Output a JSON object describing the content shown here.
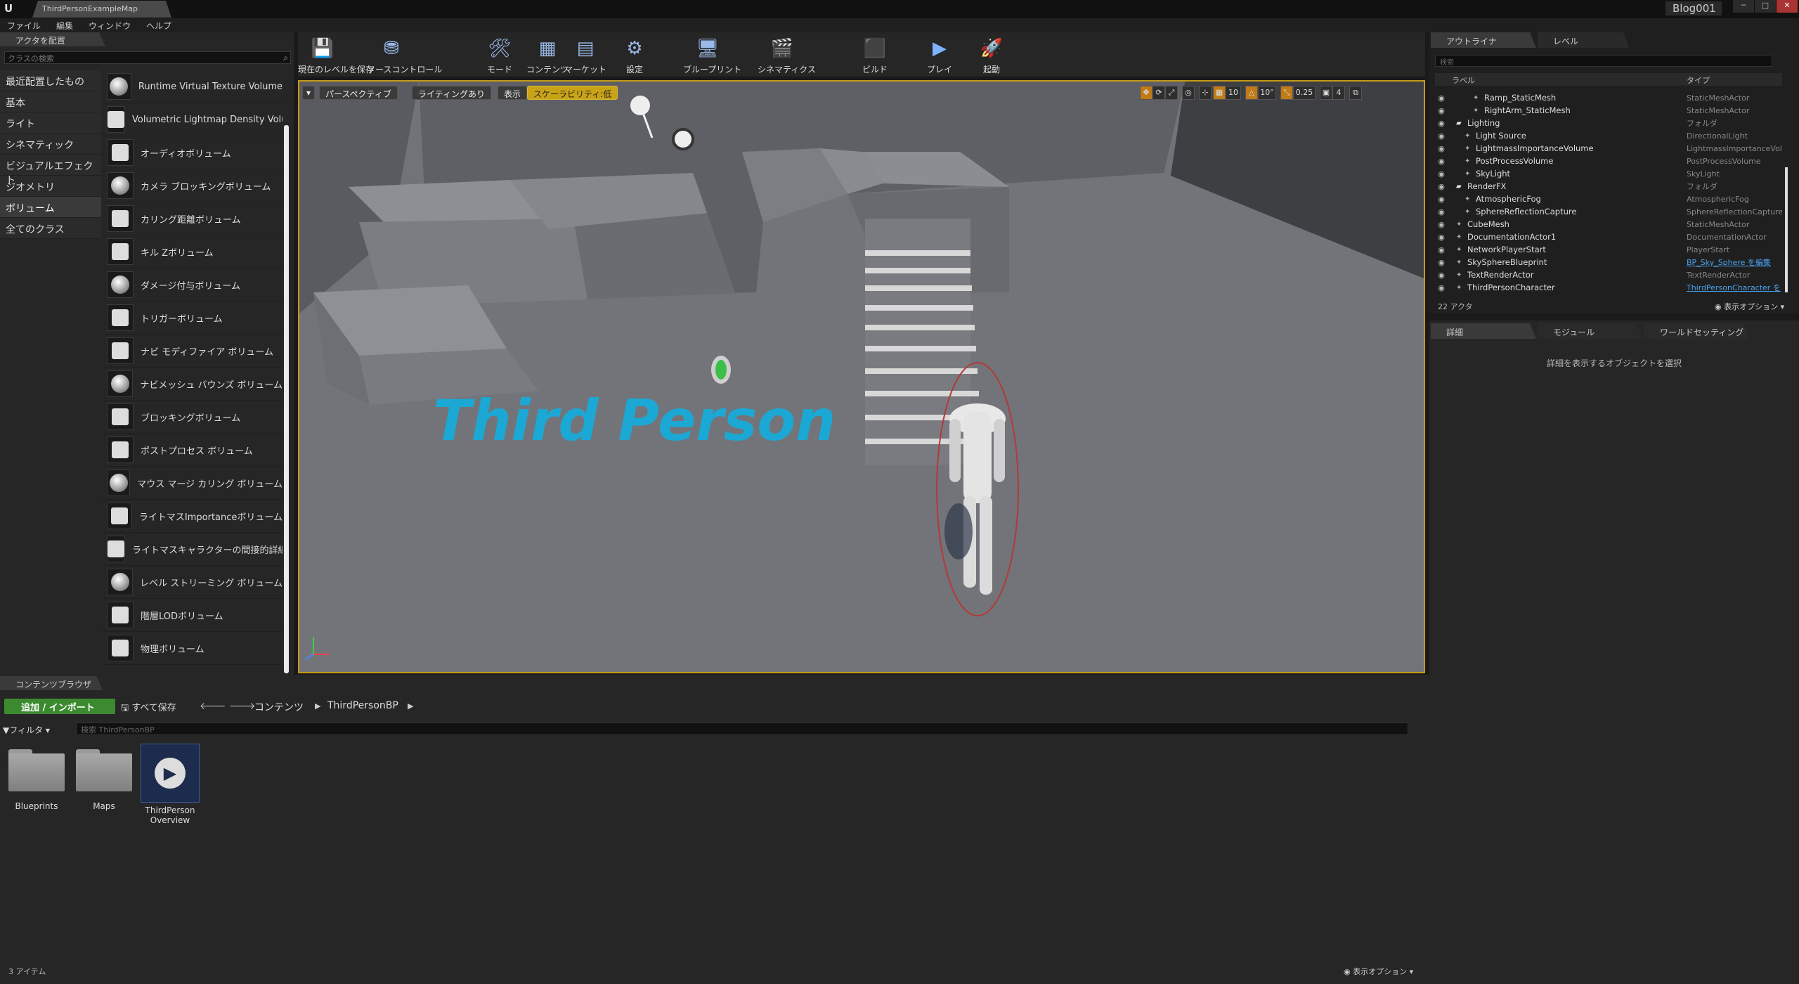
{
  "window": {
    "tab": "ThirdPersonExampleMap",
    "project": "Blog001",
    "min": "─",
    "max": "□",
    "close": "✕"
  },
  "menu": [
    "ファイル",
    "編集",
    "ウィンドウ",
    "ヘルプ"
  ],
  "place_panel": {
    "tab": "アクタを配置",
    "search_placeholder": "クラスの検索",
    "categories": [
      "最近配置したもの",
      "基本",
      "ライト",
      "シネマティック",
      "ビジュアルエフェクト",
      "ジオメトリ",
      "ボリューム",
      "全てのクラス"
    ],
    "actors": [
      "Runtime Virtual Texture Volume",
      "Volumetric Lightmap Density Volum",
      "オーディオボリューム",
      "カメラ ブロッキングボリューム",
      "カリング距離ボリューム",
      "キル Zボリューム",
      "ダメージ付与ボリューム",
      "トリガーボリューム",
      "ナビ モディファイア ボリューム",
      "ナビメッシュ バウンズ ボリューム",
      "ブロッキングボリューム",
      "ポストプロセス ボリューム",
      "マウス マージ カリング ボリューム",
      "ライトマスImportanceボリューム",
      "ライトマスキャラクターの間接的詳細",
      "レベル ストリーミング ボリューム",
      "階層LODボリューム",
      "物理ボリューム"
    ]
  },
  "toolbar": [
    "現在のレベルを保存",
    "ソースコントロール",
    "モード",
    "コンテンツ",
    "マーケット",
    "設定",
    "ブループリント",
    "シネマティクス",
    "ビルド",
    "プレイ",
    "起動"
  ],
  "viewport": {
    "perspective": "パースペクティブ",
    "lighting": "ライティングあり",
    "show": "表示",
    "scalability": "スケーラビリティ:低",
    "grid": "10",
    "rot": "10°",
    "scale": "0.25",
    "cam": "4",
    "text3d": "Third Person"
  },
  "outliner": {
    "tab": "アウトライナ",
    "tab2": "レベル",
    "search_placeholder": "検索",
    "col_label": "ラベル",
    "col_type": "タイプ",
    "rows": [
      {
        "indent": 3,
        "name": "Ramp_StaticMesh",
        "type": "StaticMeshActor",
        "link": false
      },
      {
        "indent": 3,
        "name": "RightArm_StaticMesh",
        "type": "StaticMeshActor",
        "link": false
      },
      {
        "indent": 1,
        "name": "Lighting",
        "type": "フォルダ",
        "link": false,
        "folder": true
      },
      {
        "indent": 2,
        "name": "Light Source",
        "type": "DirectionalLight",
        "link": false
      },
      {
        "indent": 2,
        "name": "LightmassImportanceVolume",
        "type": "LightmassImportanceVol",
        "link": false
      },
      {
        "indent": 2,
        "name": "PostProcessVolume",
        "type": "PostProcessVolume",
        "link": false
      },
      {
        "indent": 2,
        "name": "SkyLight",
        "type": "SkyLight",
        "link": false
      },
      {
        "indent": 1,
        "name": "RenderFX",
        "type": "フォルダ",
        "link": false,
        "folder": true
      },
      {
        "indent": 2,
        "name": "AtmosphericFog",
        "type": "AtmosphericFog",
        "link": false
      },
      {
        "indent": 2,
        "name": "SphereReflectionCapture",
        "type": "SphereReflectionCapture",
        "link": false
      },
      {
        "indent": 1,
        "name": "CubeMesh",
        "type": "StaticMeshActor",
        "link": false
      },
      {
        "indent": 1,
        "name": "DocumentationActor1",
        "type": "DocumentationActor",
        "link": false
      },
      {
        "indent": 1,
        "name": "NetworkPlayerStart",
        "type": "PlayerStart",
        "link": false
      },
      {
        "indent": 1,
        "name": "SkySphereBlueprint",
        "type": "BP_Sky_Sphere を編集",
        "link": true
      },
      {
        "indent": 1,
        "name": "TextRenderActor",
        "type": "TextRenderActor",
        "link": false
      },
      {
        "indent": 1,
        "name": "ThirdPersonCharacter",
        "type": "ThirdPersonCharacter を",
        "link": true
      }
    ],
    "count": "22 アクタ",
    "view_options": "表示オプション"
  },
  "details": {
    "tab1": "詳細",
    "tab2": "モジュール",
    "tab3": "ワールドセッティング",
    "message": "詳細を表示するオブジェクトを選択"
  },
  "content_browser": {
    "tab": "コンテンツブラウザ",
    "add": "追加 / インポート",
    "save_all": "すべて保存",
    "crumb_root": "コンテンツ",
    "crumb_folder": "ThirdPersonBP",
    "filters": "フィルタ",
    "search_placeholder": "検索 ThirdPersonBP",
    "assets": [
      "Blueprints",
      "Maps",
      "ThirdPerson Overview"
    ],
    "count": "3 アイテム",
    "view_options": "表示オプション"
  }
}
